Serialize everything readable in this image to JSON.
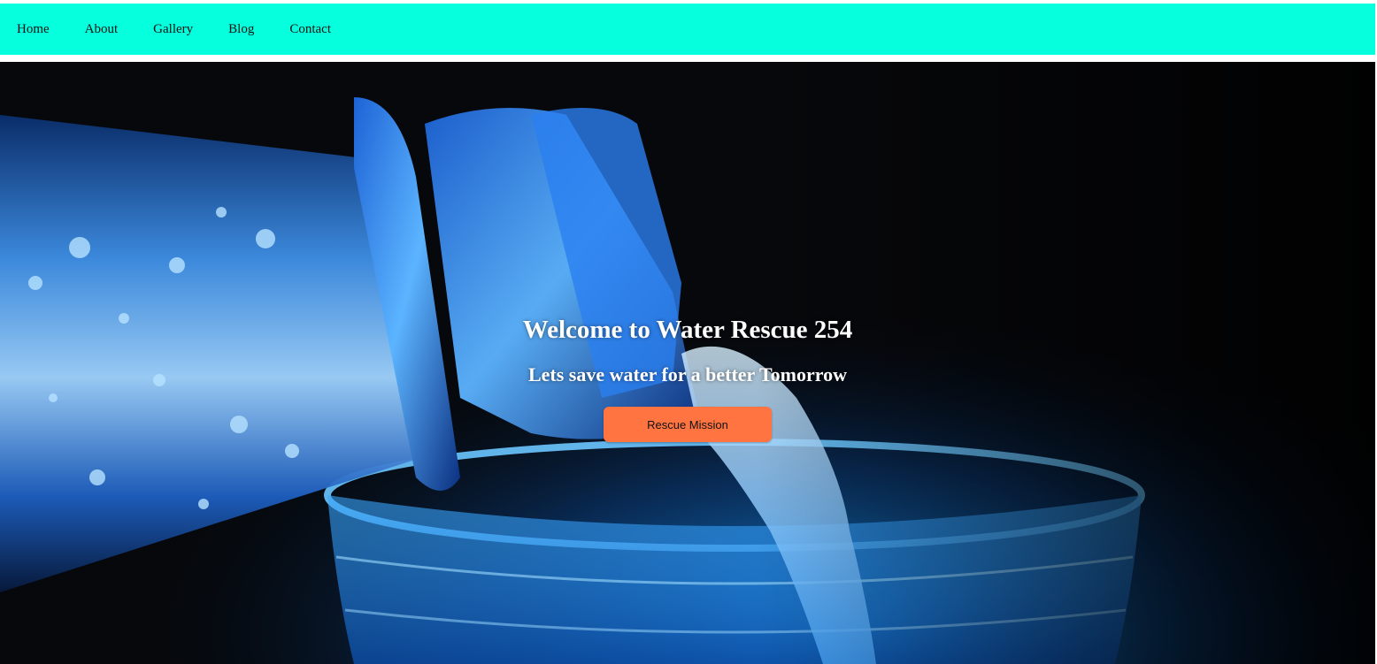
{
  "nav": {
    "items": [
      {
        "label": "Home"
      },
      {
        "label": "About"
      },
      {
        "label": "Gallery"
      },
      {
        "label": "Blog"
      },
      {
        "label": "Contact"
      }
    ]
  },
  "hero": {
    "title": "Welcome to Water Rescue 254",
    "subtitle": "Lets save water for a better Tomorrow",
    "button_label": "Rescue Mission",
    "image": "water-bottle-pouring-into-glass"
  },
  "colors": {
    "nav_background": "#06ffdc",
    "button_background": "#ff7440",
    "hero_text": "#ffffff",
    "water_blue": "#1b8fe8"
  }
}
